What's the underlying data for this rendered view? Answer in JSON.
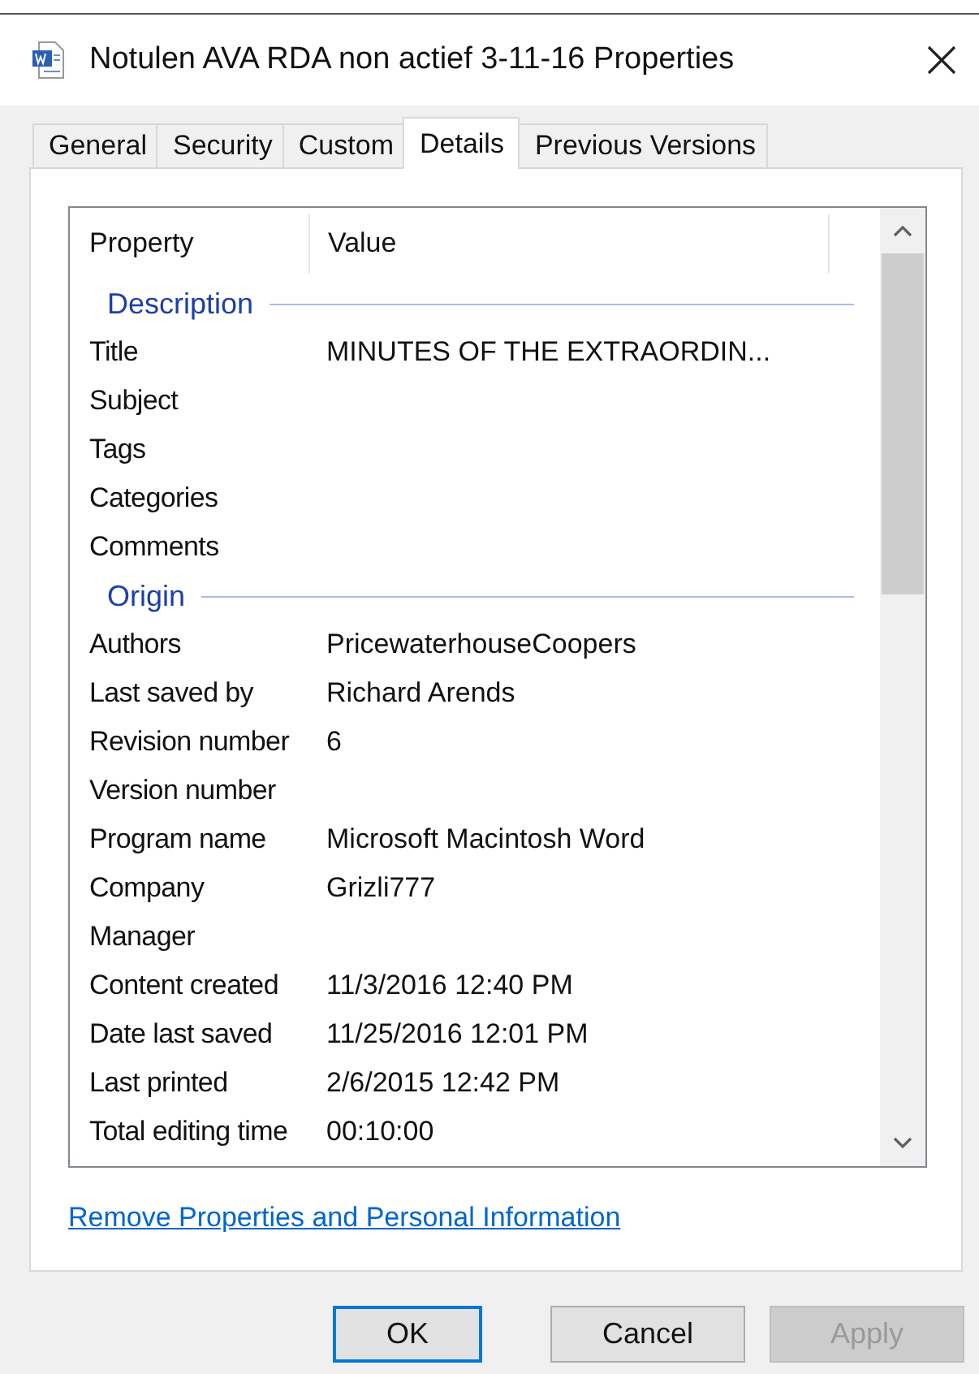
{
  "window": {
    "title": "Notulen AVA RDA non actief 3-11-16 Properties"
  },
  "tabs": [
    {
      "label": "General",
      "selected": false
    },
    {
      "label": "Security",
      "selected": false
    },
    {
      "label": "Custom",
      "selected": false
    },
    {
      "label": "Details",
      "selected": true
    },
    {
      "label": "Previous Versions",
      "selected": false
    }
  ],
  "list": {
    "columns": [
      "Property",
      "Value"
    ],
    "rows": [
      {
        "kind": "group",
        "label": "Description"
      },
      {
        "kind": "property",
        "name": "Title",
        "value": "MINUTES OF THE EXTRAORDIN..."
      },
      {
        "kind": "property",
        "name": "Subject"
      },
      {
        "kind": "property",
        "name": "Tags"
      },
      {
        "kind": "property",
        "name": "Categories"
      },
      {
        "kind": "property",
        "name": "Comments"
      },
      {
        "kind": "group",
        "label": "Origin"
      },
      {
        "kind": "property",
        "name": "Authors",
        "value": "PricewaterhouseCoopers"
      },
      {
        "kind": "property",
        "name": "Last saved by",
        "value": "Richard Arends"
      },
      {
        "kind": "property",
        "name": "Revision number",
        "value": "6"
      },
      {
        "kind": "property",
        "name": "Version number"
      },
      {
        "kind": "property",
        "name": "Program name",
        "value": "Microsoft Macintosh Word"
      },
      {
        "kind": "property",
        "name": "Company",
        "value": "Grizli777"
      },
      {
        "kind": "property",
        "name": "Manager"
      },
      {
        "kind": "property",
        "name": "Content created",
        "value": "11/3/2016 12:40 PM"
      },
      {
        "kind": "property",
        "name": "Date last saved",
        "value": "11/25/2016 12:01 PM"
      },
      {
        "kind": "property",
        "name": "Last printed",
        "value": "2/6/2015 12:42 PM"
      },
      {
        "kind": "property",
        "name": "Total editing time",
        "value": "00:10:00"
      }
    ]
  },
  "link": "Remove Properties and Personal Information",
  "buttons": [
    {
      "label": "OK",
      "default": true,
      "disabled": false
    },
    {
      "label": "Cancel",
      "default": false,
      "disabled": false
    },
    {
      "label": "Apply",
      "default": false,
      "disabled": true
    }
  ]
}
